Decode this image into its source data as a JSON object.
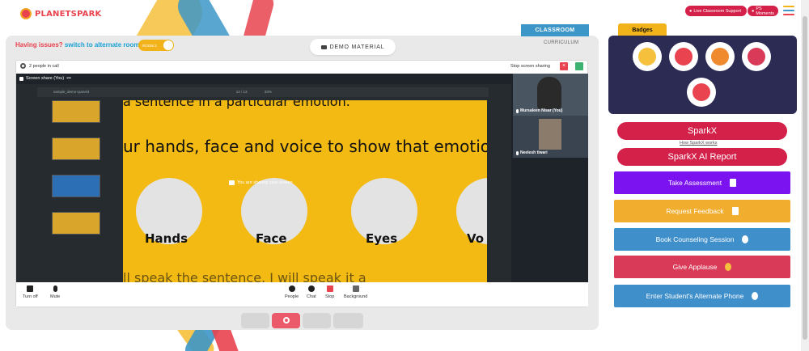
{
  "brand": {
    "logo_text": "PLANETSPARK"
  },
  "header": {
    "live_support": "Live Classroom Support",
    "ps_moments": "PS Moments"
  },
  "stage": {
    "issue_prefix": "Having issues?",
    "issue_link": "switch to alternate room",
    "room_toggle": "ROOM 2",
    "demo_material": "DEMO MATERIAL",
    "tab_classroom": "CLASSROOM",
    "tab_curriculum": "CURRICULUM"
  },
  "call": {
    "people_in_call": "2 people in call",
    "stop_sharing": "Stop screen sharing",
    "share_label": "Screen share (You)",
    "sharing_notice": "You are sharing your screen",
    "pdf_title": "sample_demo+panel4",
    "pdf_page": "12 / 13",
    "pdf_zoom": "33%",
    "participants": [
      {
        "name": "Mursaleen Nisar (You)"
      },
      {
        "name": "Neelesh tiwari"
      }
    ],
    "slide": {
      "line1": "a sentence in a particular emotion.",
      "line2": "ur hands, face and voice to show that emotio",
      "labels": [
        "Hands",
        "Face",
        "Eyes",
        "Vo"
      ],
      "bottom_line": "ll speak the sentence. I will speak it a"
    },
    "controls": {
      "turn_off": "Turn off",
      "mute": "Mute",
      "people": "People",
      "chat": "Chat",
      "stop": "Stop",
      "background": "Background"
    }
  },
  "sidebar": {
    "badges_title": "Badges",
    "sparkx": "SparkX",
    "how_sparkx": "How SparkX works",
    "sparkx_report": "SparkX AI Report",
    "actions": [
      {
        "label": "Take Assessment",
        "color": "#7b12f0"
      },
      {
        "label": "Request Feedback",
        "color": "#f0ad2e"
      },
      {
        "label": "Book Counseling Session",
        "color": "#3f8fcb"
      },
      {
        "label": "Give Applause",
        "color": "#d93a57"
      },
      {
        "label": "Enter Student's Alternate Phone",
        "color": "#3f8fcb"
      }
    ]
  },
  "colors": {
    "brand_red": "#d4214a",
    "accent_yellow": "#f2b21a",
    "accent_blue": "#3c96c8",
    "panel_navy": "#2b2b54"
  }
}
